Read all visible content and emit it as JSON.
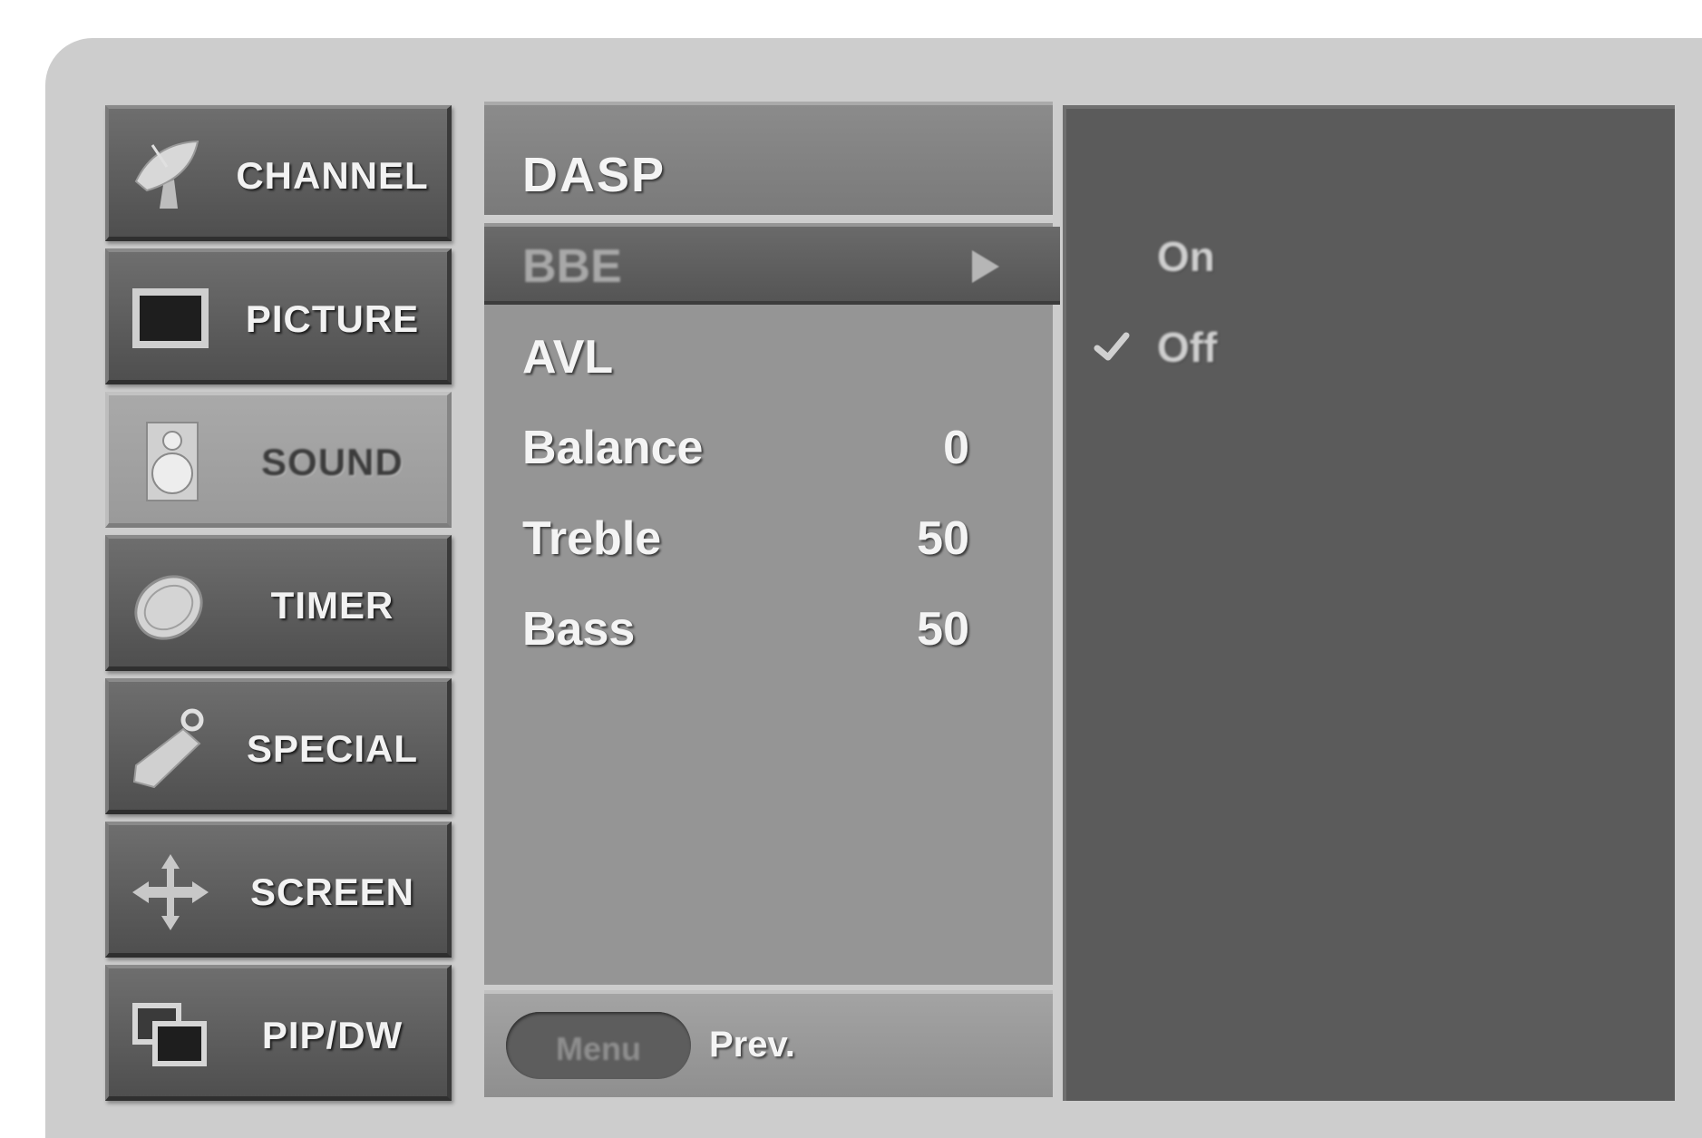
{
  "categories": [
    {
      "label": "CHANNEL",
      "icon": "satellite-dish-icon",
      "active": false
    },
    {
      "label": "PICTURE",
      "icon": "tv-screen-icon",
      "active": false
    },
    {
      "label": "SOUND",
      "icon": "speaker-icon",
      "active": true
    },
    {
      "label": "TIMER",
      "icon": "clock-icon",
      "active": false
    },
    {
      "label": "SPECIAL",
      "icon": "key-tag-icon",
      "active": false
    },
    {
      "label": "SCREEN",
      "icon": "move-arrows-icon",
      "active": false
    },
    {
      "label": "PIP/DW",
      "icon": "pip-windows-icon",
      "active": false
    }
  ],
  "submenu": {
    "title": "DASP",
    "items": [
      {
        "name": "BBE",
        "value": "",
        "selected": true
      },
      {
        "name": "AVL",
        "value": "",
        "selected": false
      },
      {
        "name": "Balance",
        "value": "0",
        "selected": false
      },
      {
        "name": "Treble",
        "value": "50",
        "selected": false
      },
      {
        "name": "Bass",
        "value": "50",
        "selected": false
      }
    ]
  },
  "footer": {
    "menu_label": "Menu",
    "prev_label": "Prev."
  },
  "options": {
    "items": [
      {
        "label": "On",
        "checked": false
      },
      {
        "label": "Off",
        "checked": true
      }
    ]
  },
  "colors": {
    "frame": "#cdcdcd",
    "category_tile": "#5d5d5d",
    "active_tile": "#9a9a9a",
    "submenu_panel": "#959595",
    "options_panel": "#5b5b5b"
  }
}
